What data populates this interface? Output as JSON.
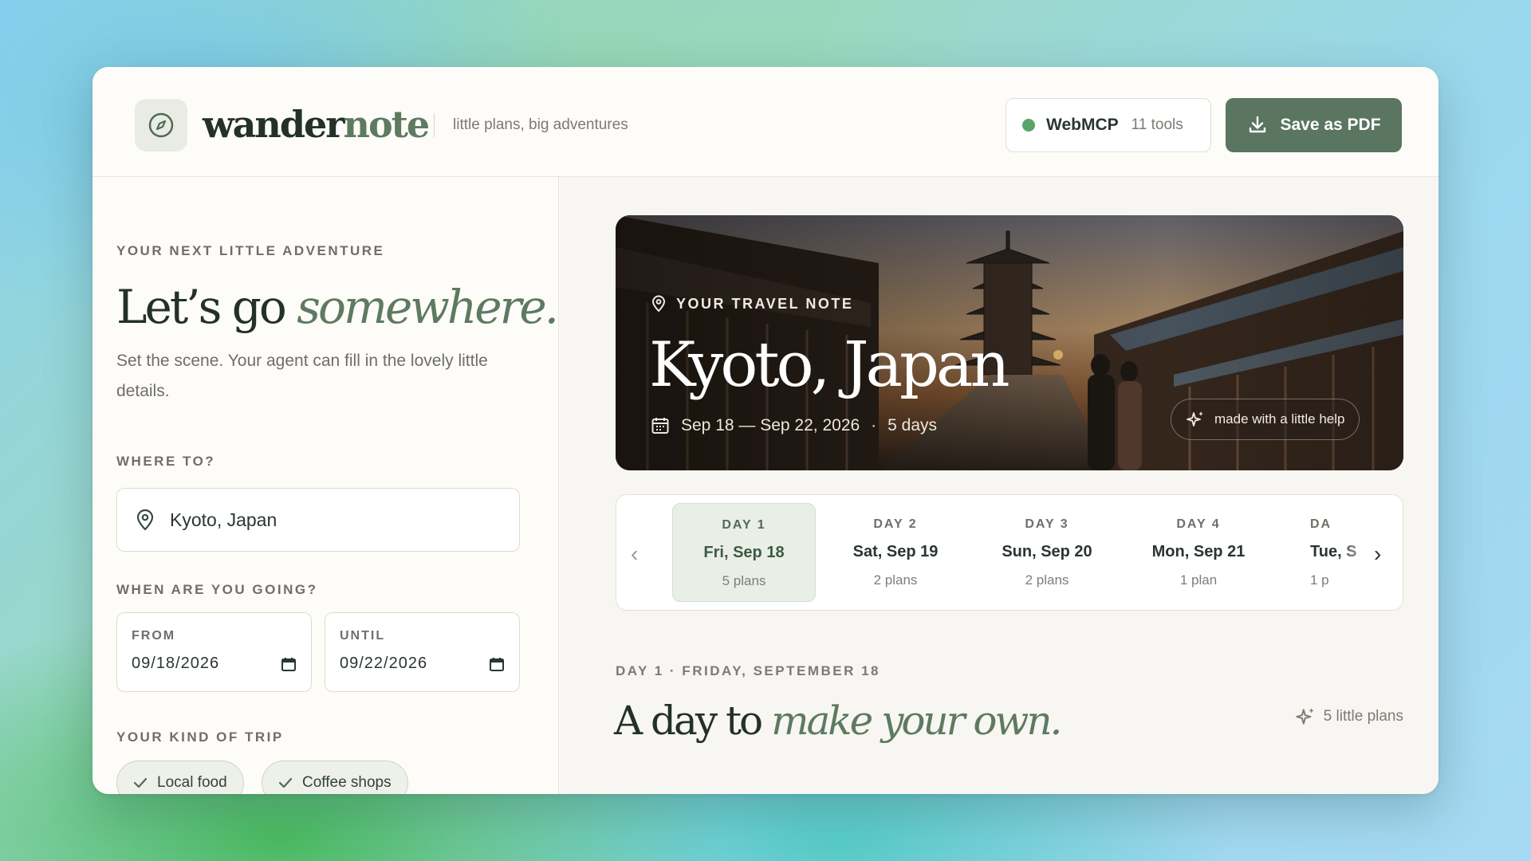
{
  "header": {
    "brand_primary": "wander",
    "brand_accent": "note",
    "tagline": "little plans, big adventures",
    "webmcp_label": "WebMCP",
    "webmcp_count": "11 tools",
    "save_label": "Save as PDF"
  },
  "left": {
    "eyebrow": "YOUR NEXT LITTLE ADVENTURE",
    "title_plain": "Let’s go ",
    "title_italic": "somewhere.",
    "lead": "Set the scene. Your agent can fill in the lovely little details.",
    "where_label": "WHERE TO?",
    "where_value": "Kyoto, Japan",
    "when_label": "WHEN ARE YOU GOING?",
    "from_label": "FROM",
    "from_value": "09/18/2026",
    "until_label": "UNTIL",
    "until_value": "09/22/2026",
    "trip_label": "YOUR KIND OF TRIP",
    "chips": [
      "Local food",
      "Coffee shops"
    ]
  },
  "hero": {
    "eyebrow": "YOUR TRAVEL NOTE",
    "title": "Kyoto, Japan",
    "dates": "Sep 18 — Sep 22, 2026",
    "sep": "·",
    "duration": "5 days",
    "help": "made with a little help"
  },
  "days": [
    {
      "label": "DAY 1",
      "date": "Fri, Sep 18",
      "plans": "5 plans"
    },
    {
      "label": "DAY 2",
      "date": "Sat, Sep 19",
      "plans": "2 plans"
    },
    {
      "label": "DAY 3",
      "date": "Sun, Sep 20",
      "plans": "2 plans"
    },
    {
      "label": "DAY 4",
      "date": "Mon, Sep 21",
      "plans": "1 plan"
    },
    {
      "label": "DA",
      "date": "Tue, S",
      "plans": "1 p"
    }
  ],
  "day_detail": {
    "eyebrow": "DAY 1 · FRIDAY, SEPTEMBER 18",
    "title_plain": "A day to ",
    "title_italic": "make your own.",
    "plans_count": "5 little plans"
  },
  "colors": {
    "accent": "#5e7a60",
    "button": "#5a7560",
    "status_dot": "#5aa46a"
  }
}
